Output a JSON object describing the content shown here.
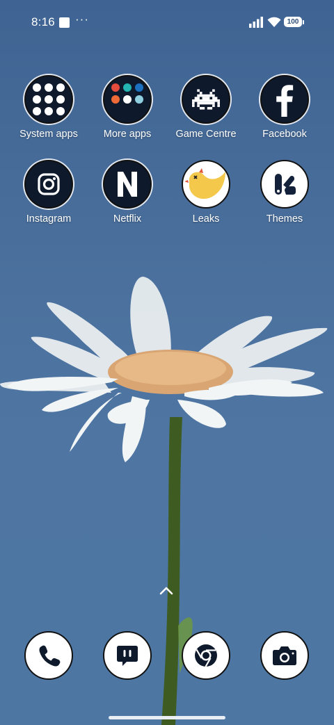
{
  "status_bar": {
    "time": "8:16",
    "more": "···",
    "battery": "100"
  },
  "apps": [
    {
      "label": "System apps",
      "icon": "folder-icon"
    },
    {
      "label": "More apps",
      "icon": "folder-icon"
    },
    {
      "label": "Game Centre",
      "icon": "space-invader-icon"
    },
    {
      "label": "Facebook",
      "icon": "facebook-icon"
    },
    {
      "label": "Instagram",
      "icon": "instagram-icon"
    },
    {
      "label": "Netflix",
      "icon": "netflix-icon"
    },
    {
      "label": "Leaks",
      "icon": "bird-icon"
    },
    {
      "label": "Themes",
      "icon": "themes-icon"
    }
  ],
  "dock": [
    {
      "icon": "phone-icon"
    },
    {
      "icon": "messages-icon"
    },
    {
      "icon": "chrome-icon"
    },
    {
      "icon": "camera-icon"
    }
  ],
  "colors": {
    "sky": "#4a6f9c",
    "icon_dark": "#0e1a2c",
    "leaks_yellow": "#f3c84b"
  }
}
